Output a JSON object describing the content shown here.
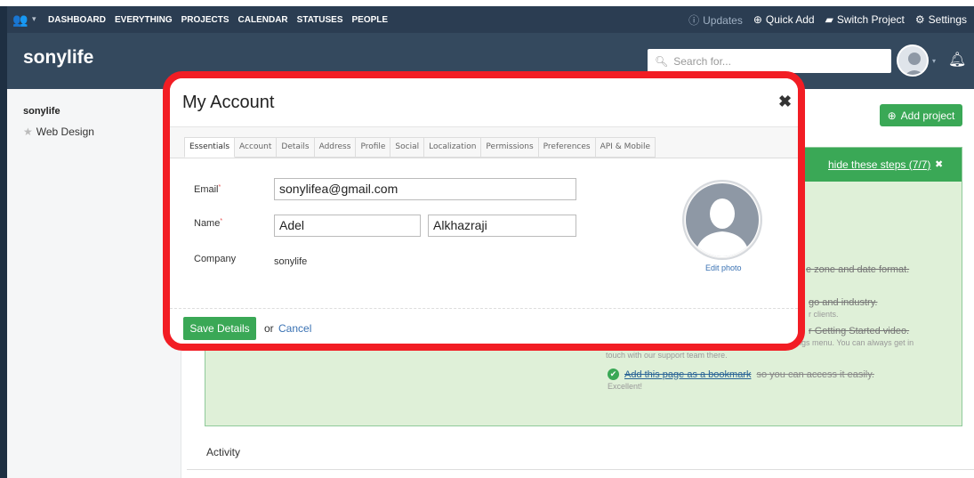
{
  "nav": {
    "items": [
      "DASHBOARD",
      "EVERYTHING",
      "PROJECTS",
      "CALENDAR",
      "STATUSES",
      "PEOPLE"
    ],
    "updates": "Updates",
    "quick_add": "Quick Add",
    "switch_project": "Switch Project",
    "settings": "Settings"
  },
  "header": {
    "brand": "sonylife",
    "search_placeholder": "Search for..."
  },
  "sidebar": {
    "title": "sonylife",
    "item": "Web Design"
  },
  "page": {
    "add_project": "Add project",
    "hide_steps": "hide these steps (7/7)",
    "step_timezone": "e zone and date format.",
    "step_logo": "go and industry.",
    "step_logo_sub": "r clients.",
    "step_video": "r Getting Started video.",
    "step_video_sub": "ings menu. You can always get in",
    "step_video_sub2": "touch with our support team there.",
    "bookmark_link": "Add this page as a bookmark",
    "bookmark_rest": "so you can access it easily.",
    "bookmark_sub": "Excellent!",
    "activity": "Activity"
  },
  "modal": {
    "title": "My Account",
    "close": "✖",
    "tabs": [
      "Essentials",
      "Account",
      "Details",
      "Address",
      "Profile",
      "Social",
      "Localization",
      "Permissions",
      "Preferences",
      "API & Mobile"
    ],
    "active_tab": "Essentials",
    "email_label": "Email",
    "email_value": "sonylifea@gmail.com",
    "name_label": "Name",
    "first_name": "Adel",
    "last_name": "Alkhazraji",
    "company_label": "Company",
    "company_value": "sonylife",
    "edit_photo": "Edit photo",
    "save_label": "Save Details",
    "or_text": "or",
    "cancel_label": "Cancel"
  },
  "colors": {
    "nav_bg": "#2b3d52",
    "header_bg": "#34495e",
    "accent_green": "#3aa856",
    "highlight_red": "#f21d24",
    "link_blue": "#3a72b3"
  }
}
